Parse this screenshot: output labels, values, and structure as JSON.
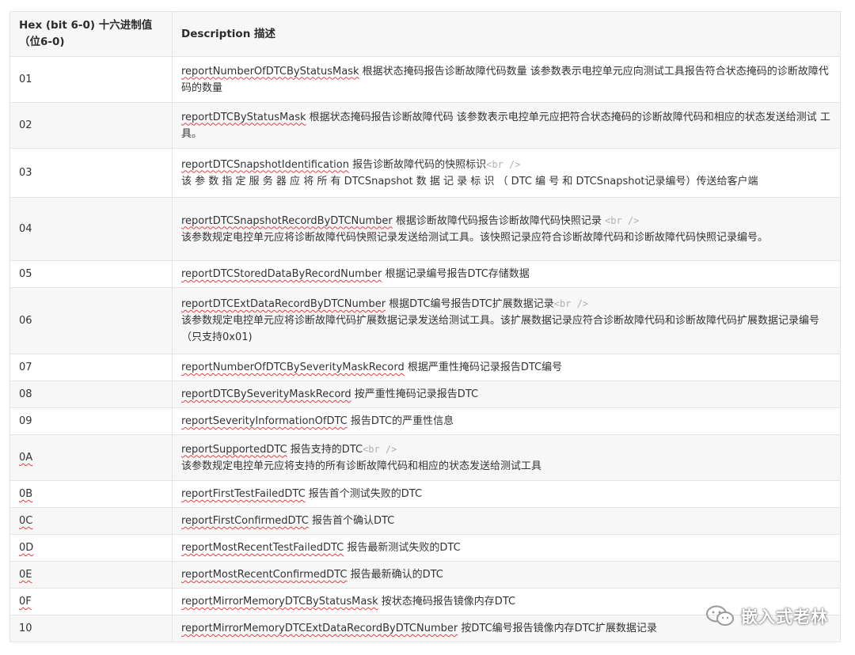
{
  "table": {
    "header": {
      "hex": "Hex (bit 6-0) 十六进制值（位6-0)",
      "desc": "Description 描述"
    },
    "rows": [
      {
        "hex": "01",
        "fn": "reportNumberOfDTCByStatusMask",
        "text": " 根据状态掩码报告诊断故障代码数量 该参数表示电控单元应向测试工具报告符合状态掩码的诊断故障代码的数量",
        "br": "",
        "text2": ""
      },
      {
        "hex": "02",
        "fn": "reportDTCByStatusMask",
        "text": " 根据状态掩码报告诊断故障代码 该参数表示电控单元应把符合状态掩码的诊断故障代码和相应的状态发送给测试 工具。",
        "br": "",
        "text2": ""
      },
      {
        "hex": "03",
        "fn": "reportDTCSnapshotIdentification",
        "text": " 报告诊断故障代码的快照标识",
        "br": "<br />",
        "text2": "该 参 数 指 定 服 务 器 应 将 所 有 DTCSnapshot 数 据 记 录 标 识 （ DTC 编 号 和 DTCSnapshot记录编号）传送给客户端"
      },
      {
        "hex": "04",
        "fn": "reportDTCSnapshotRecordByDTCNumber",
        "text": " 根据诊断故障代码报告诊断故障代码快照记录 ",
        "br": "<br />",
        "text2": "该参数规定电控单元应将诊断故障代码快照记录发送给测试工具。该快照记录应符合诊断故障代码和诊断故障代码快照记录编号。"
      },
      {
        "hex": "05",
        "fn": "reportDTCStoredDataByRecordNumber",
        "text": " 根据记录编号报告DTC存储数据",
        "br": "",
        "text2": ""
      },
      {
        "hex": "06",
        "fn": "reportDTCExtDataRecordByDTCNumber",
        "text": " 根据DTC编号报告DTC扩展数据记录",
        "br": "<br />",
        "text2": "该参数规定电控单元应将诊断故障代码扩展数据记录发送给测试工具。该扩展数据记录应符合诊断故障代码和诊断故障代码扩展数据记录编号（只支持0x01)"
      },
      {
        "hex": "07",
        "fn": "reportNumberOfDTCBySeverityMaskRecord",
        "text": " 根据严重性掩码记录报告DTC编号",
        "br": "",
        "text2": ""
      },
      {
        "hex": "08",
        "fn": "reportDTCBySeverityMaskRecord",
        "text": " 按严重性掩码记录报告DTC",
        "br": "",
        "text2": ""
      },
      {
        "hex": "09",
        "fn": "reportSeverityInformationOfDTC",
        "text": " 报告DTC的严重性信息",
        "br": "",
        "text2": ""
      },
      {
        "hex": "0A",
        "fn": "reportSupportedDTC",
        "text": " 报告支持的DTC",
        "br": "<br />",
        "text2": "该参数规定电控单元应将支持的所有诊断故障代码和相应的状态发送给测试工具"
      },
      {
        "hex": "0B",
        "fn": "reportFirstTestFailedDTC",
        "text": " 报告首个测试失败的DTC",
        "br": "",
        "text2": ""
      },
      {
        "hex": "0C",
        "fn": "reportFirstConfirmedDTC",
        "text": " 报告首个确认DTC",
        "br": "",
        "text2": ""
      },
      {
        "hex": "0D",
        "fn": "reportMostRecentTestFailedDTC",
        "text": " 报告最新测试失败的DTC",
        "br": "",
        "text2": ""
      },
      {
        "hex": "0E",
        "fn": "reportMostRecentConfirmedDTC",
        "text": " 报告最新确认的DTC",
        "br": "",
        "text2": ""
      },
      {
        "hex": "0F",
        "fn": "reportMirrorMemoryDTCByStatusMask",
        "text": " 按状态掩码报告镜像内存DTC",
        "br": "",
        "text2": ""
      },
      {
        "hex": "10",
        "fn": "reportMirrorMemoryDTCExtDataRecordByDTCNumber",
        "text": " 按DTC编号报告镜像内存DTC扩展数据记录",
        "br": "",
        "text2": ""
      }
    ]
  },
  "watermark": {
    "text": "嵌入式老林",
    "icon": "wechat-icon"
  }
}
